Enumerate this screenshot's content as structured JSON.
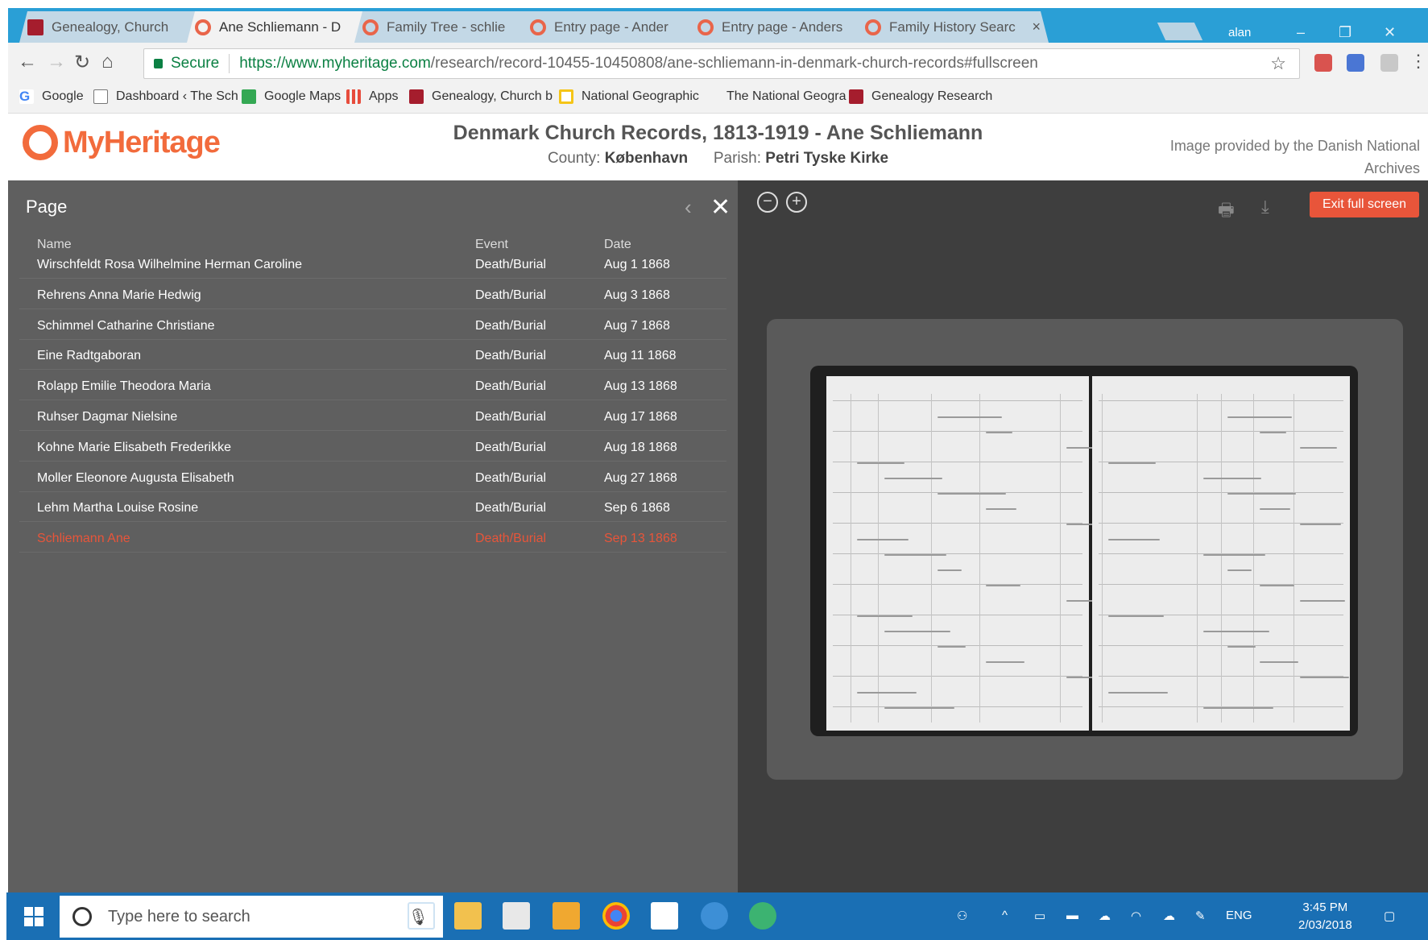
{
  "browser": {
    "tabs": [
      {
        "label": "Genealogy, Church",
        "icon": "genealogy-favicon",
        "active": false
      },
      {
        "label": "Ane Schliemann - D",
        "icon": "myheritage-favicon",
        "active": true
      },
      {
        "label": "Family Tree - schlie",
        "icon": "myheritage-favicon",
        "active": false
      },
      {
        "label": "Entry page - Ander",
        "icon": "myheritage-favicon",
        "active": false
      },
      {
        "label": "Entry page - Anders",
        "icon": "myheritage-favicon",
        "active": false
      },
      {
        "label": "Family History Searc",
        "icon": "myheritage-favicon",
        "active": false
      }
    ],
    "tab_close_glyph": "×",
    "profile_name": "alan",
    "secure_label": "Secure",
    "url_host": "https://www.myheritage.com",
    "url_path": "/research/record-10455-10450808/ane-schliemann-in-denmark-church-records#fullscreen",
    "bookmarks": [
      {
        "label": "Google",
        "icon": "google-icon"
      },
      {
        "label": "Dashboard ‹ The Sch",
        "icon": "page-icon"
      },
      {
        "label": "Google Maps",
        "icon": "maps-icon"
      },
      {
        "label": "Apps",
        "icon": "apps-grid-icon"
      },
      {
        "label": "Genealogy, Church b",
        "icon": "genealogy-icon"
      },
      {
        "label": "National Geographic",
        "icon": "natgeo-icon"
      },
      {
        "label": "The National Geogra",
        "icon": "blank-icon"
      },
      {
        "label": "Genealogy Research",
        "icon": "genealogy-icon"
      }
    ]
  },
  "site": {
    "logo_text": "MyHeritage",
    "record_title": "Denmark Church Records, 1813-1919 - Ane Schliemann",
    "county_label": "County:",
    "county_value": "København",
    "parish_label": "Parish:",
    "parish_value": "Petri Tyske Kirke",
    "image_credit": "Image provided by the Danish National Archives"
  },
  "panel": {
    "title": "Page",
    "columns": {
      "name": "Name",
      "event": "Event",
      "date": "Date"
    },
    "rows": [
      {
        "name": "Wirschfeldt Rosa Wilhelmine Herman Caroline",
        "event": "Death/Burial",
        "date": "Aug 1 1868"
      },
      {
        "name": "Rehrens Anna Marie Hedwig",
        "event": "Death/Burial",
        "date": "Aug 3 1868"
      },
      {
        "name": "Schimmel Catharine Christiane",
        "event": "Death/Burial",
        "date": "Aug 7 1868"
      },
      {
        "name": "Eine Radtgaboran",
        "event": "Death/Burial",
        "date": "Aug 11 1868"
      },
      {
        "name": "Rolapp Emilie Theodora Maria",
        "event": "Death/Burial",
        "date": "Aug 13 1868"
      },
      {
        "name": "Ruhser Dagmar Nielsine",
        "event": "Death/Burial",
        "date": "Aug 17 1868"
      },
      {
        "name": "Kohne Marie Elisabeth Frederikke",
        "event": "Death/Burial",
        "date": "Aug 18 1868"
      },
      {
        "name": "Moller Eleonore Augusta Elisabeth",
        "event": "Death/Burial",
        "date": "Aug 27 1868"
      },
      {
        "name": "Lehm Martha Louise Rosine",
        "event": "Death/Burial",
        "date": "Sep 6 1868"
      },
      {
        "name": "Schliemann Ane",
        "event": "Death/Burial",
        "date": "Sep 13 1868"
      }
    ],
    "selected_index": 9
  },
  "viewer": {
    "exit_label": "Exit full screen",
    "zoom_out_glyph": "−",
    "zoom_in_glyph": "+"
  },
  "taskbar": {
    "search_placeholder": "Type here to search",
    "language": "ENG",
    "time": "3:45 PM",
    "date": "2/03/2018"
  },
  "colors": {
    "brand": "#f26b3c",
    "highlight": "#e8553a",
    "panel_bg": "#5f5f5f",
    "viewer_bg": "#3e3e3e",
    "tabstrip": "#2a9fd6",
    "taskbar": "#1a6fb4"
  }
}
